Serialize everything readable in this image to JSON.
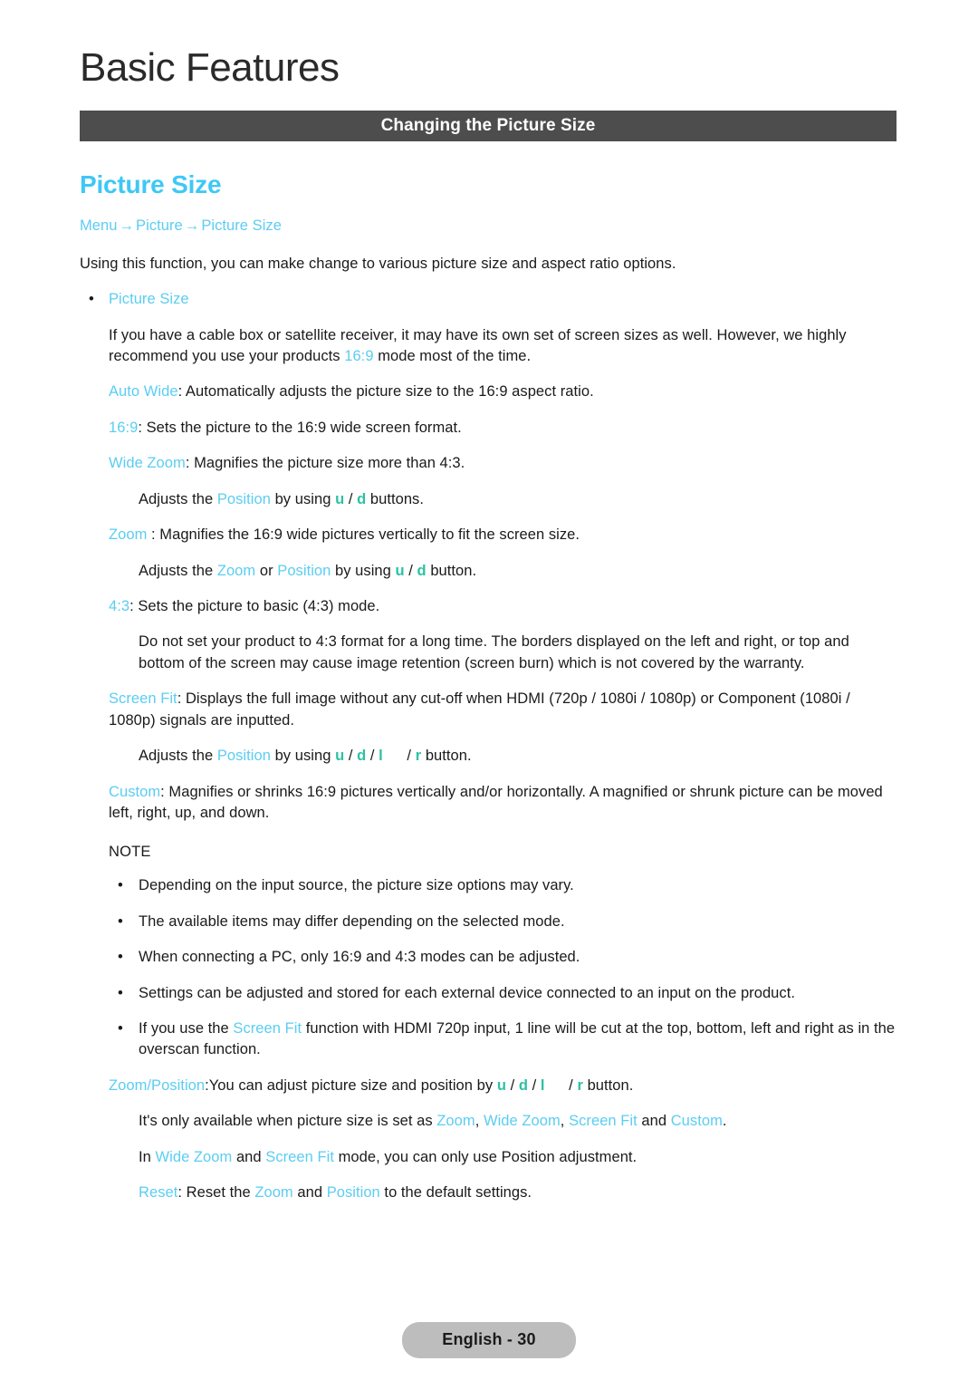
{
  "document": {
    "title": "Basic Features",
    "section_bar_label": "Changing the Picture Size",
    "heading": "Picture Size",
    "breadcrumb": {
      "item1": "Menu",
      "arrow1": "→",
      "item2": "Picture",
      "arrow2": "→",
      "item3": "Picture Size"
    },
    "intro": "Using this function, you can make change to various picture size and aspect ratio options.",
    "bullet_picture_size": "Picture Size",
    "cable_box_note_a": "If you have a cable box or satellite receiver, it may have its own set of screen sizes as well. However, we highly recommend you use your products ",
    "cable_box_note_ratio": "16:9",
    "cable_box_note_b": " mode most of the time.",
    "auto_wide_term": "Auto Wide",
    "auto_wide_desc": ": Automatically adjusts the picture size to the 16:9 aspect ratio.",
    "sixteen_nine_term": "16:9",
    "sixteen_nine_desc": ": Sets the picture to the 16:9 wide screen format.",
    "wide_zoom_term": "Wide Zoom",
    "wide_zoom_desc": ": Magnifies the picture size more than 4:3.",
    "wide_zoom_adjust_a": "Adjusts the ",
    "wide_zoom_adjust_position": "Position",
    "wide_zoom_adjust_b": " by using ",
    "btn_u": "u",
    "btn_d": "d",
    "btn_l": "l",
    "btn_r": "r",
    "slash": " / ",
    "wide_zoom_adjust_c": " buttons.",
    "zoom_term": "Zoom",
    "zoom_desc": " : Magnifies the 16:9 wide pictures vertically to fit the screen size.",
    "zoom_adjust_a": "Adjusts the ",
    "zoom_adjust_zoom": "Zoom",
    "zoom_adjust_or": " or ",
    "zoom_adjust_position": "Position",
    "zoom_adjust_b": " by using ",
    "zoom_adjust_c": " button.",
    "four_three_term": "4:3",
    "four_three_desc": ": Sets the picture to basic (4:3) mode.",
    "four_three_warning": "Do not set your product to 4:3 format for a long time. The borders displayed on the left and right, or top and bottom of the screen may cause image retention (screen burn) which is not covered by the warranty.",
    "screen_fit_term": "Screen Fit",
    "screen_fit_desc": ": Displays the full image without any cut-off when HDMI (720p / 1080i / 1080p) or Component (1080i / 1080p) signals are inputted.",
    "screen_fit_adjust_a": "Adjusts the ",
    "screen_fit_adjust_position": "Position",
    "screen_fit_adjust_b": " by using ",
    "screen_fit_adjust_c": " button.",
    "custom_term": "Custom",
    "custom_desc": ": Magnifies or shrinks 16:9 pictures vertically and/or horizontally. A magnified or shrunk picture can be moved left, right, up, and down.",
    "note_label": "NOTE",
    "notes": [
      "Depending on the input source, the picture size options may vary.",
      "The available items may differ depending on the selected mode.",
      "When connecting a PC, only 16:9 and 4:3 modes can be adjusted.",
      "Settings can be adjusted and stored for each external device connected to an input on the product."
    ],
    "note_screen_fit_a": "If you use the ",
    "note_screen_fit_term": "Screen Fit",
    "note_screen_fit_b": " function with HDMI 720p input, 1 line will be cut at the top, bottom, left and right as in the overscan function.",
    "zoom_position_term": "Zoom/Position",
    "zoom_position_a": ":You can adjust picture size and position by ",
    "zoom_position_b": " button.",
    "avail_a": "It's only available when picture size is set as ",
    "avail_zoom": "Zoom",
    "avail_sep1": ", ",
    "avail_wide_zoom": "Wide Zoom",
    "avail_sep2": ", ",
    "avail_screen_fit": "Screen Fit",
    "avail_and": " and ",
    "avail_custom": "Custom",
    "avail_end": ".",
    "mode_a": "In ",
    "mode_wide_zoom": "Wide Zoom",
    "mode_and": " and ",
    "mode_screen_fit": "Screen Fit",
    "mode_b": " mode, you can only use Position adjustment.",
    "reset_term": "Reset",
    "reset_a": ": Reset the ",
    "reset_zoom": "Zoom",
    "reset_and": " and ",
    "reset_position": "Position",
    "reset_b": " to the default settings.",
    "footer_label": "English - 30",
    "bullet_glyph": "•",
    "colors": {
      "cyan": "#5bcdf2",
      "heading_cyan": "#3ec8f5",
      "green": "#2dc1a3",
      "bar_gray": "#4d4d4d",
      "pill_gray": "#bdbdbd"
    }
  }
}
